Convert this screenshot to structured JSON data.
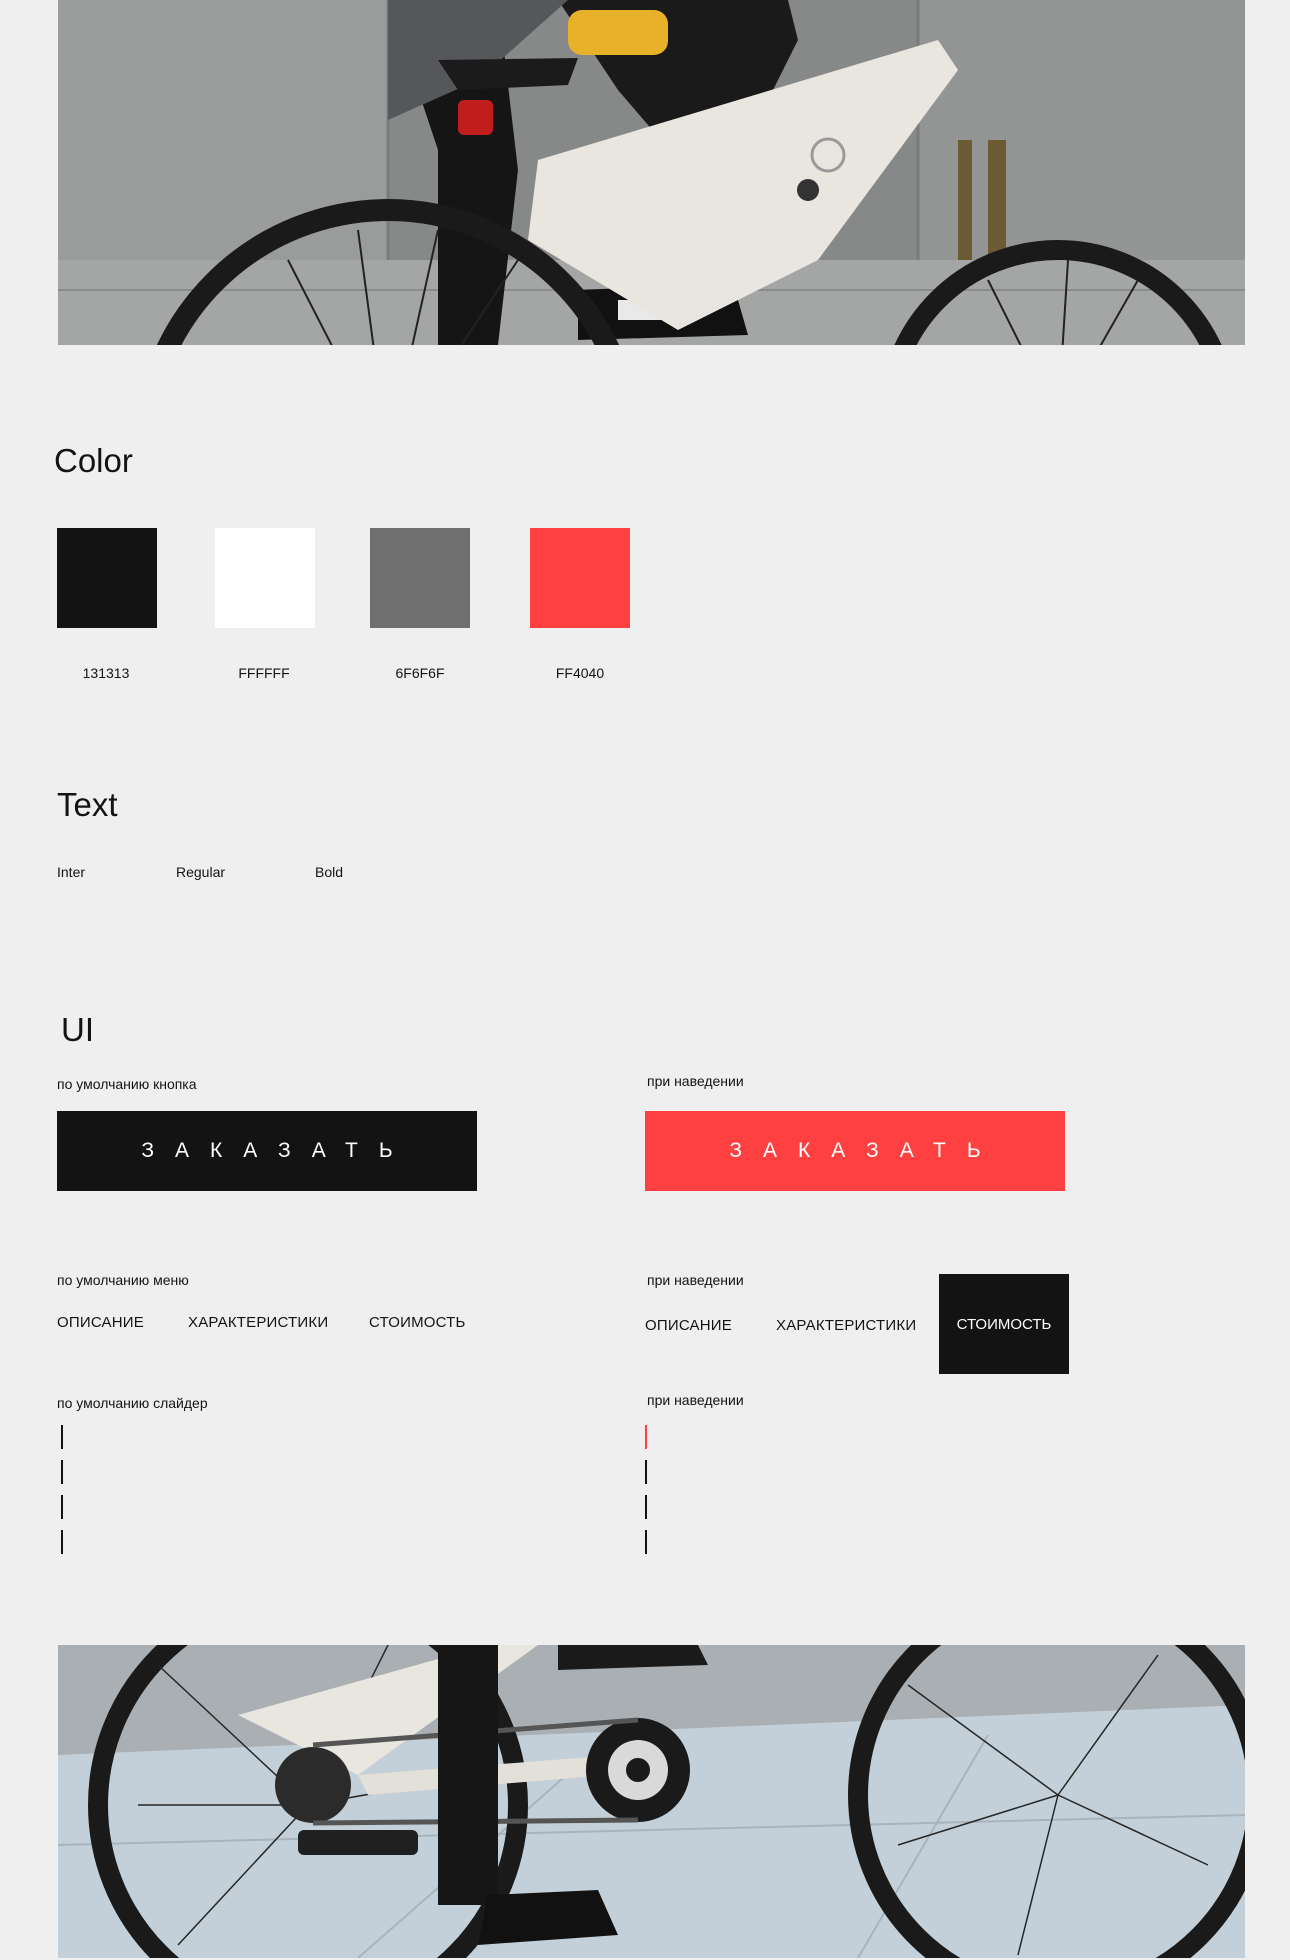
{
  "colors_section": {
    "title": "Color",
    "swatches": [
      {
        "hex": "#131313",
        "label": "131313"
      },
      {
        "hex": "#FFFFFF",
        "label": "FFFFFF"
      },
      {
        "hex": "#6F6F6F",
        "label": "6F6F6F"
      },
      {
        "hex": "#FF4040",
        "label": "FF4040"
      }
    ]
  },
  "text_section": {
    "title": "Text",
    "font": "Inter",
    "weights": [
      "Regular",
      "Bold"
    ]
  },
  "ui_section": {
    "title": "UI",
    "button_default_label": "по умолчанию кнопка",
    "button_hover_label": "при наведении",
    "button_text": "ЗАКАЗАТЬ",
    "menu_default_label": "по умолчанию меню",
    "menu_hover_label": "при наведении",
    "menu_items": [
      "ОПИСАНИЕ",
      "ХАРАКТЕРИСТИКИ",
      "СТОИМОСТЬ"
    ],
    "slider_default_label": "по умолчанию слайдер",
    "slider_hover_label": "при наведении",
    "slider_default_colors": [
      "#131313",
      "#131313",
      "#131313",
      "#131313"
    ],
    "slider_hover_colors": [
      "#FF4040",
      "#131313",
      "#131313",
      "#131313"
    ]
  },
  "theme": {
    "background": "#EFEFEF",
    "dark": "#131313",
    "accent": "#FF4040",
    "white": "#FFFFFF"
  }
}
